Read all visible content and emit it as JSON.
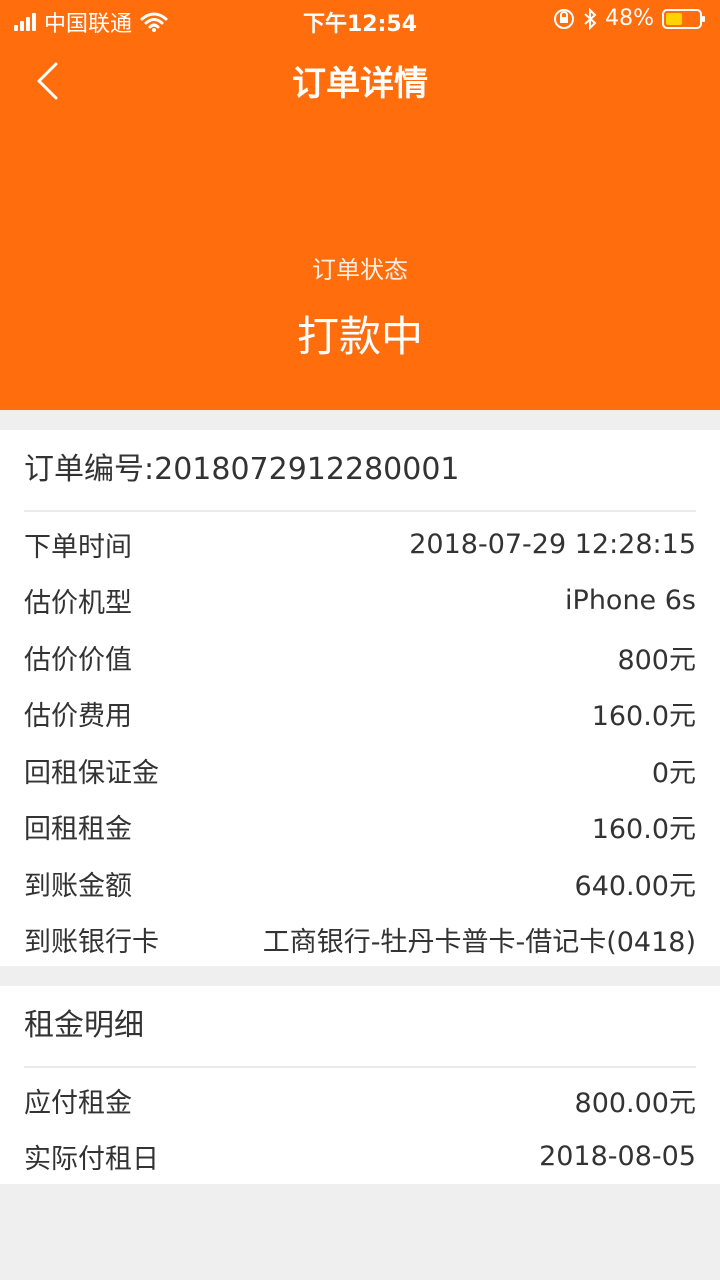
{
  "status_bar": {
    "carrier": "中国联通",
    "time": "下午12:54",
    "battery": "48%"
  },
  "nav": {
    "title": "订单详情"
  },
  "order_status": {
    "label": "订单状态",
    "value": "打款中"
  },
  "order": {
    "number_text": "订单编号:2018072912280001",
    "rows": [
      {
        "label": "下单时间",
        "value": "2018-07-29 12:28:15"
      },
      {
        "label": "估价机型",
        "value": "iPhone 6s"
      },
      {
        "label": "估价价值",
        "value": "800元"
      },
      {
        "label": "估价费用",
        "value": "160.0元"
      },
      {
        "label": "回租保证金",
        "value": "0元"
      },
      {
        "label": "回租租金",
        "value": "160.0元"
      },
      {
        "label": "到账金额",
        "value": "640.00元"
      },
      {
        "label": "到账银行卡",
        "value": "工商银行-牡丹卡普卡-借记卡(0418)"
      }
    ]
  },
  "rent_detail": {
    "title": "租金明细",
    "rows": [
      {
        "label": "应付租金",
        "value": "800.00元"
      },
      {
        "label": "实际付租日",
        "value": "2018-08-05"
      }
    ]
  },
  "colors": {
    "brand_orange": "#ff6d0c",
    "background": "#efefef"
  }
}
